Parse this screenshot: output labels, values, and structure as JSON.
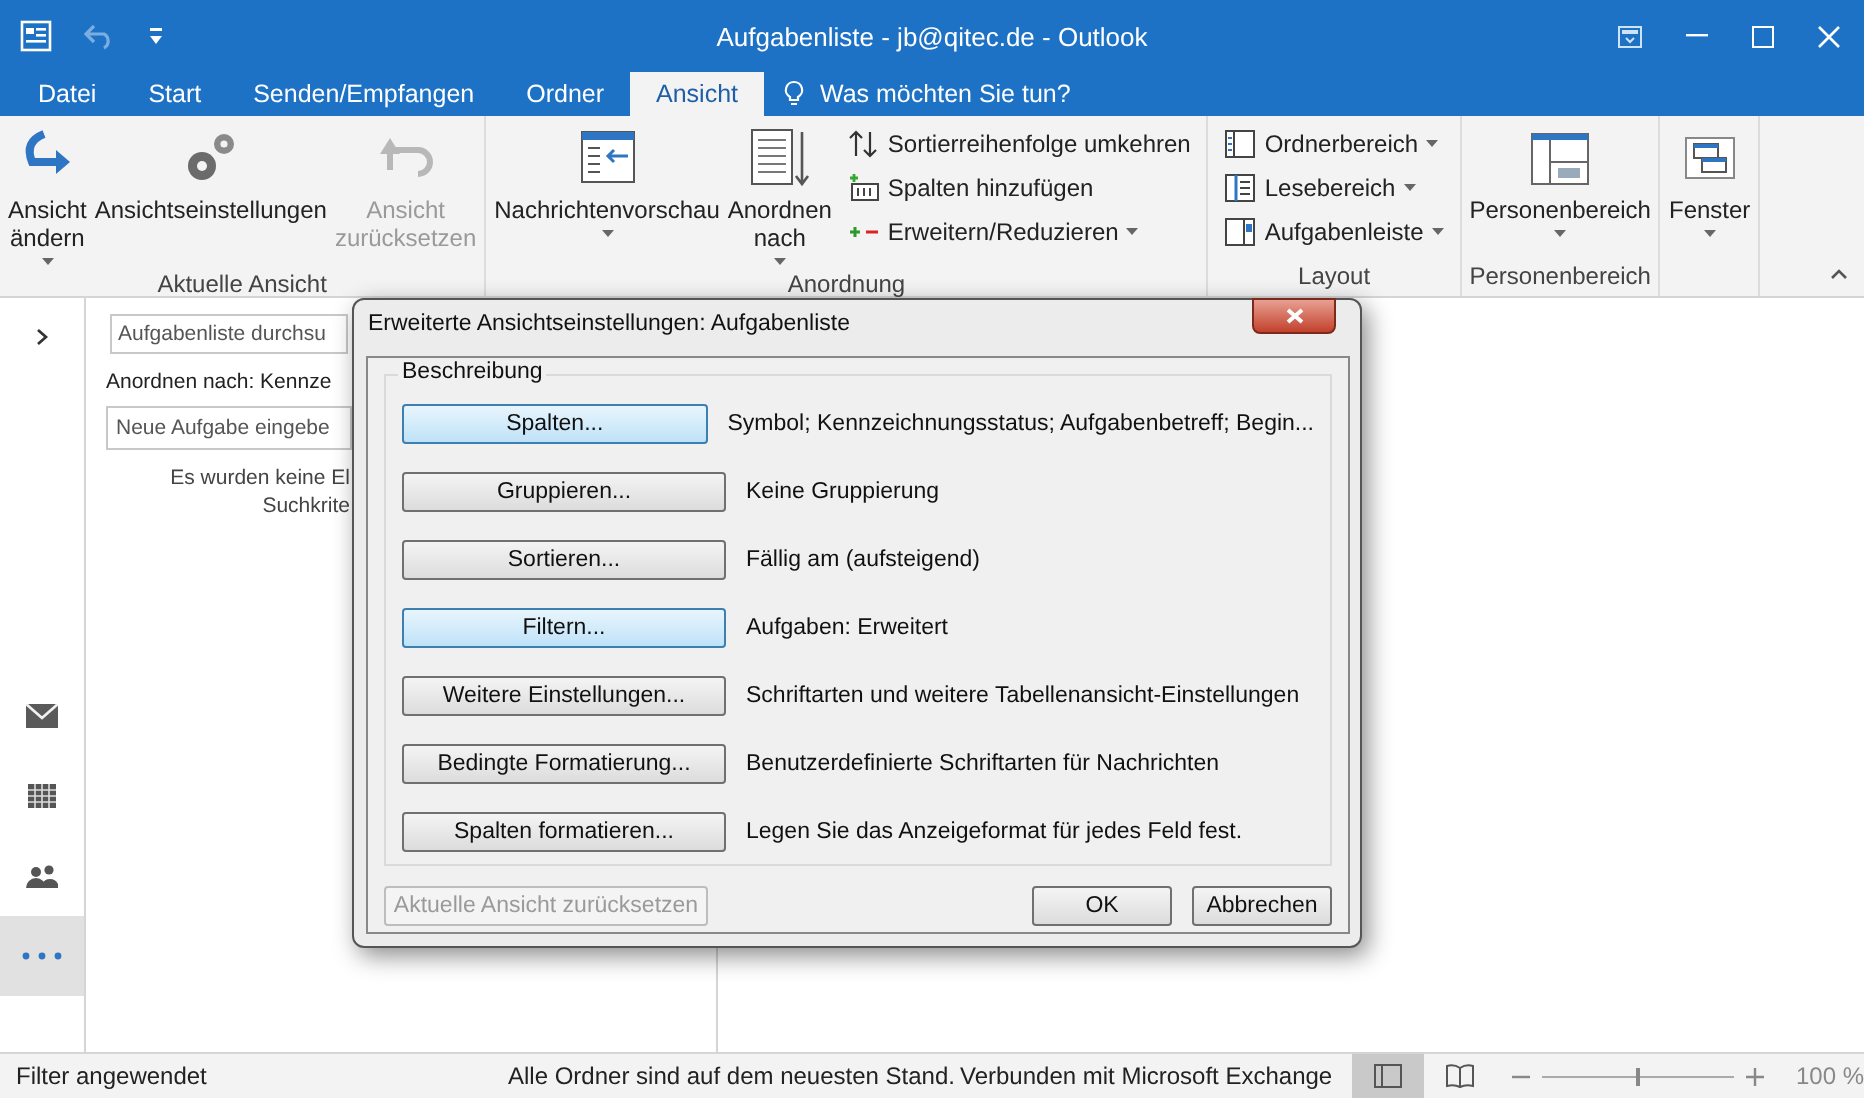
{
  "window": {
    "title": "Aufgabenliste - jb@qitec.de - Outlook"
  },
  "tabs": [
    {
      "label": "Datei",
      "selected": false
    },
    {
      "label": "Start",
      "selected": false
    },
    {
      "label": "Senden/Empfangen",
      "selected": false
    },
    {
      "label": "Ordner",
      "selected": false
    },
    {
      "label": "Ansicht",
      "selected": true
    }
  ],
  "tell_me": {
    "placeholder": "Was möchten Sie tun?"
  },
  "ribbon": [
    {
      "label": "Aktuelle Ansicht",
      "items": [
        {
          "kind": "large",
          "lines": [
            "Ansicht",
            "ändern"
          ],
          "dropdown": true,
          "disabled": false
        },
        {
          "kind": "large",
          "lines": [
            "Ansichtseinstellungen"
          ],
          "dropdown": false,
          "disabled": false
        },
        {
          "kind": "large",
          "lines": [
            "Ansicht",
            "zurücksetzen"
          ],
          "dropdown": false,
          "disabled": true
        }
      ]
    },
    {
      "label": "Anordnung",
      "items": [
        {
          "kind": "large",
          "lines": [
            "Nachrichtenvorschau"
          ],
          "dropdown": true,
          "disabled": false
        },
        {
          "kind": "large",
          "lines": [
            "Anordnen",
            "nach"
          ],
          "dropdown": true,
          "disabled": false
        },
        {
          "kind": "small",
          "lines": [
            "Sortierreihenfolge umkehren"
          ],
          "dropdown": false,
          "disabled": false
        },
        {
          "kind": "small",
          "lines": [
            "Spalten hinzufügen"
          ],
          "dropdown": false,
          "disabled": false
        },
        {
          "kind": "small",
          "lines": [
            "Erweitern/Reduzieren"
          ],
          "dropdown": true,
          "disabled": false
        }
      ]
    },
    {
      "label": "Layout",
      "items": [
        {
          "kind": "small",
          "lines": [
            "Ordnerbereich"
          ],
          "dropdown": true,
          "disabled": false
        },
        {
          "kind": "small",
          "lines": [
            "Lesebereich"
          ],
          "dropdown": true,
          "disabled": false
        },
        {
          "kind": "small",
          "lines": [
            "Aufgabenleiste"
          ],
          "dropdown": true,
          "disabled": false
        }
      ]
    },
    {
      "label": "Personenbereich",
      "items": [
        {
          "kind": "large",
          "lines": [
            "Personenbereich"
          ],
          "dropdown": true,
          "disabled": false
        }
      ]
    },
    {
      "items": [
        {
          "kind": "large",
          "lines": [
            "Fenster"
          ],
          "dropdown": true,
          "disabled": false
        }
      ]
    }
  ],
  "nav": [
    {
      "selected": false
    },
    {
      "selected": false
    },
    {
      "selected": false
    },
    {
      "selected": true
    }
  ],
  "task_pane": {
    "search": {
      "placeholder": "Aufgabenliste durchsu"
    },
    "arrange": "Anordnen nach: Kennze",
    "new_task": {
      "placeholder": "Neue Aufgabe eingebe"
    },
    "empty_lines": [
      "Es wurden keine El",
      "Suchkrite"
    ]
  },
  "dialog": {
    "title": "Erweiterte Ansichtseinstellungen: Aufgabenliste",
    "group": "Beschreibung",
    "rows": [
      {
        "button": "Spalten...",
        "description": "Symbol; Kennzeichnungsstatus; Aufgabenbetreff; Begin...",
        "highlighted": true
      },
      {
        "button": "Gruppieren...",
        "description": "Keine Gruppierung",
        "highlighted": false
      },
      {
        "button": "Sortieren...",
        "description": "Fällig am (aufsteigend)",
        "highlighted": false
      },
      {
        "button": "Filtern...",
        "description": "Aufgaben: Erweitert",
        "highlighted": true
      },
      {
        "button": "Weitere Einstellungen...",
        "description": "Schriftarten und weitere Tabellenansicht-Einstellungen",
        "highlighted": false
      },
      {
        "button": "Bedingte Formatierung...",
        "description": "Benutzerdefinierte Schriftarten für Nachrichten",
        "highlighted": false
      },
      {
        "button": "Spalten formatieren...",
        "description": "Legen Sie das Anzeigeformat für jedes Feld fest.",
        "highlighted": false
      }
    ],
    "reset": {
      "label": "Aktuelle Ansicht zurücksetzen",
      "disabled": true
    },
    "buttons": [
      "OK",
      "Abbrechen"
    ]
  },
  "status_bar": {
    "left": "Filter angewendet",
    "sync": "Alle Ordner sind auf dem neuesten Stand.",
    "connection": "Verbunden mit Microsoft Exchange",
    "views": [
      {
        "selected": true
      },
      {
        "selected": false
      }
    ],
    "zoom": {
      "level": 0.5,
      "label": "100 %"
    }
  }
}
